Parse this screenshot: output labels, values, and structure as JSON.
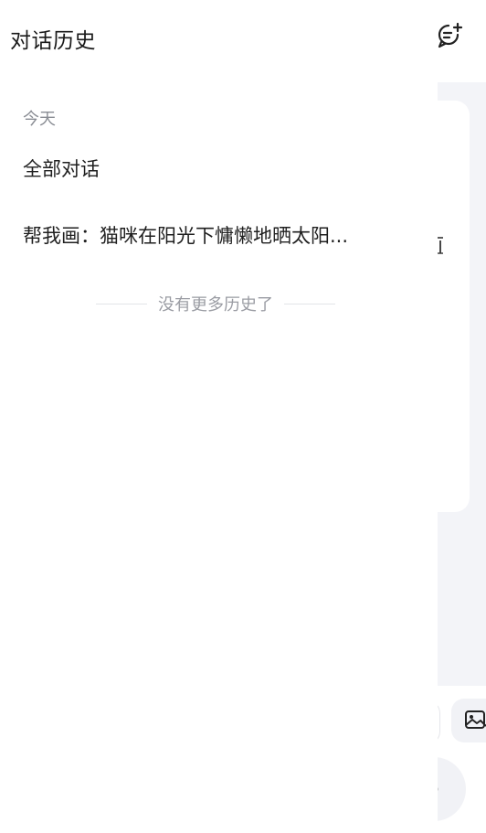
{
  "drawer": {
    "title": "对话历史",
    "section_label": "今天",
    "items": [
      {
        "label": "全部对话"
      },
      {
        "label": "帮我画：猫咪在阳光下慵懒地晒太阳..."
      }
    ],
    "end_note": "没有更多历史了"
  },
  "background": {
    "icons": [
      "new-chat-icon",
      "image-icon",
      "mic-icon"
    ]
  },
  "colors": {
    "drawer_bg": "#ffffff",
    "page_bg": "#f3f4f8",
    "title_text": "#1a1a1a",
    "muted_text": "#8a8d94"
  }
}
